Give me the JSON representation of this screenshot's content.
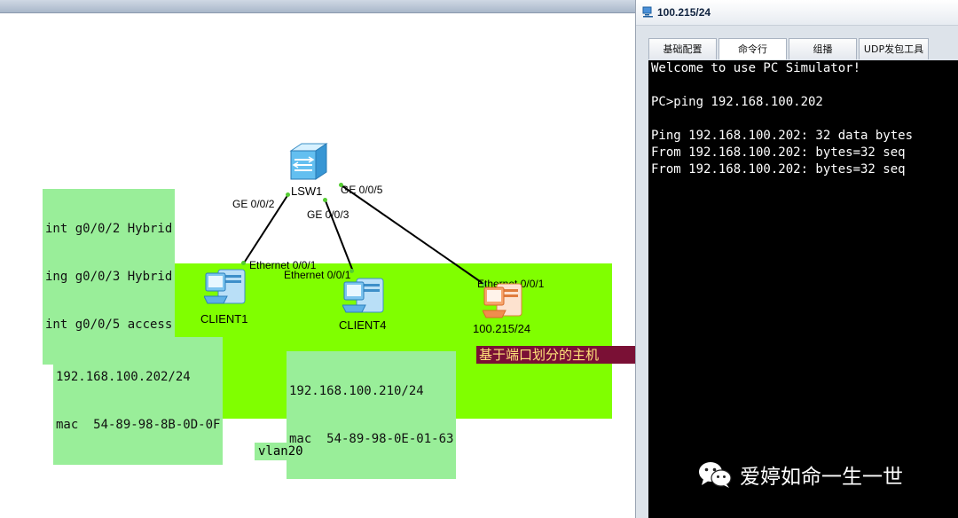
{
  "topology": {
    "config_note": {
      "lines": [
        "int g0/0/2 Hybrid",
        "ing g0/0/3 Hybrid",
        "int g0/0/5 access"
      ]
    },
    "switch": {
      "name": "LSW1",
      "icon": "switch-icon"
    },
    "ports": {
      "sw_ge002": "GE 0/0/2",
      "sw_ge003": "GE 0/0/3",
      "sw_ge005": "GE 0/0/5",
      "client1_eth": "Ethernet 0/0/1",
      "client4_eth": "Ethernet 0/0/1",
      "host_eth": "Ethernet 0/0/1"
    },
    "devices": {
      "client1": {
        "name": "CLIENT1",
        "icon": "client-pc-icon"
      },
      "client4": {
        "name": "CLIENT4",
        "icon": "client-pc-icon"
      },
      "host": {
        "name": "100.215/24",
        "icon": "pc-icon"
      }
    },
    "notes": {
      "client1_info": [
        "192.168.100.202/24",
        "mac  54-89-98-8B-0D-0F"
      ],
      "client4_info": [
        "192.168.100.210/24",
        "mac  54-89-98-0E-01-63"
      ],
      "host_desc": "基于端口划分的主机 ",
      "vlan": "vlan20"
    },
    "colors": {
      "area": "#80ff00",
      "note_bg": "#99ee99",
      "link": "#000000",
      "port_dot": "#55cc33",
      "desc_bg": "#7a1035",
      "desc_fg": "#ffe27a"
    }
  },
  "pc_window": {
    "title": "100.215/24",
    "title_icon": "pc-simulator-icon",
    "tabs": [
      "基础配置",
      "命令行",
      "组播",
      "UDP发包工具"
    ],
    "active_tab": "命令行",
    "terminal_lines": [
      "Welcome to use PC Simulator!",
      "",
      "PC>ping 192.168.100.202",
      "",
      "Ping 192.168.100.202: 32 data bytes",
      "From 192.168.100.202: bytes=32 seq",
      "From 192.168.100.202: bytes=32 seq"
    ]
  },
  "watermark": {
    "text": "爱婷如命一生一世",
    "icon": "wechat-icon"
  }
}
